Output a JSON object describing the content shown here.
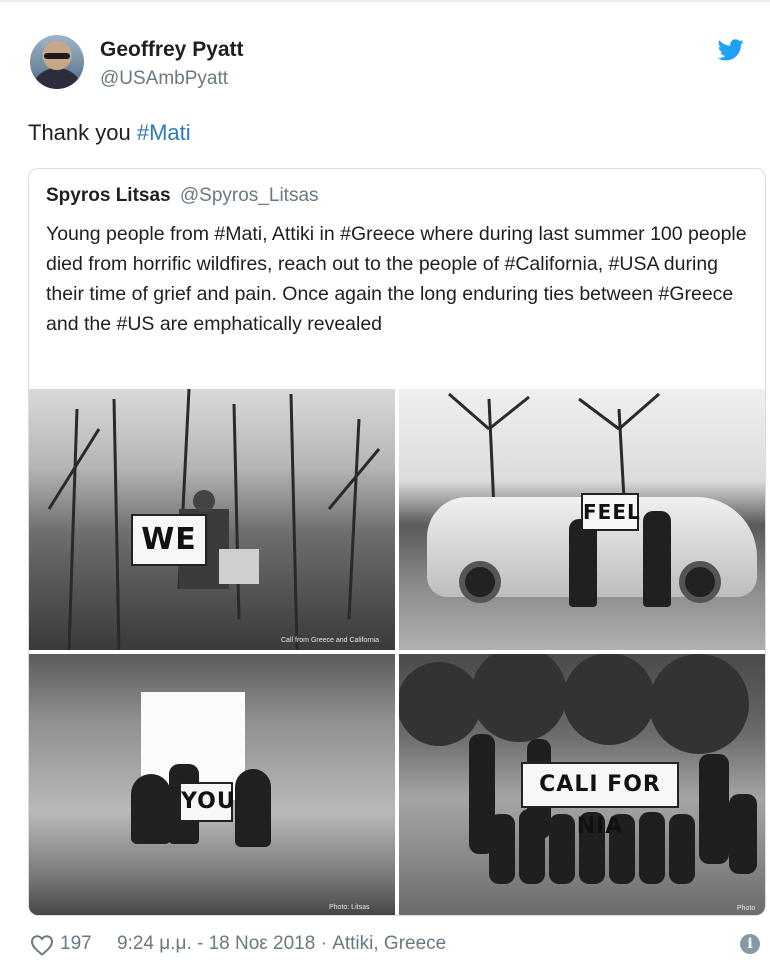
{
  "author": {
    "name": "Geoffrey Pyatt",
    "handle": "@USAmbPyatt"
  },
  "tweet": {
    "text_plain": "Thank you ",
    "hashtag": "#Mati"
  },
  "quoted_tweet": {
    "name": "Spyros Litsas",
    "handle": "@Spyros_Litsas",
    "body": "Young people from #Mati, Attiki in #Greece where during last summer 100 people died from horrific wildfires,  reach out to the people of #California, #USA during their time of grief and pain. Once again the long enduring ties between #Greece and the #US are emphatically revealed",
    "photos": [
      {
        "sign": "WE",
        "caption": "Call from Greece and California"
      },
      {
        "sign": "FEEL"
      },
      {
        "sign": "YOU",
        "caption": "Photo: Litsas"
      },
      {
        "sign": "CALI FOR NIA",
        "caption": "Photo"
      }
    ]
  },
  "footer": {
    "likes": "197",
    "timestamp": "9:24 μ.μ. - 18 Νοε 2018 · Attiki, Greece"
  },
  "colors": {
    "link": "#2b7bb9",
    "secondary_text": "#697882",
    "twitter_blue": "#1da1f2",
    "border": "#d8dee3"
  },
  "icons": {
    "brand": "twitter-bird-icon",
    "like": "heart-icon",
    "info": "info-icon"
  }
}
